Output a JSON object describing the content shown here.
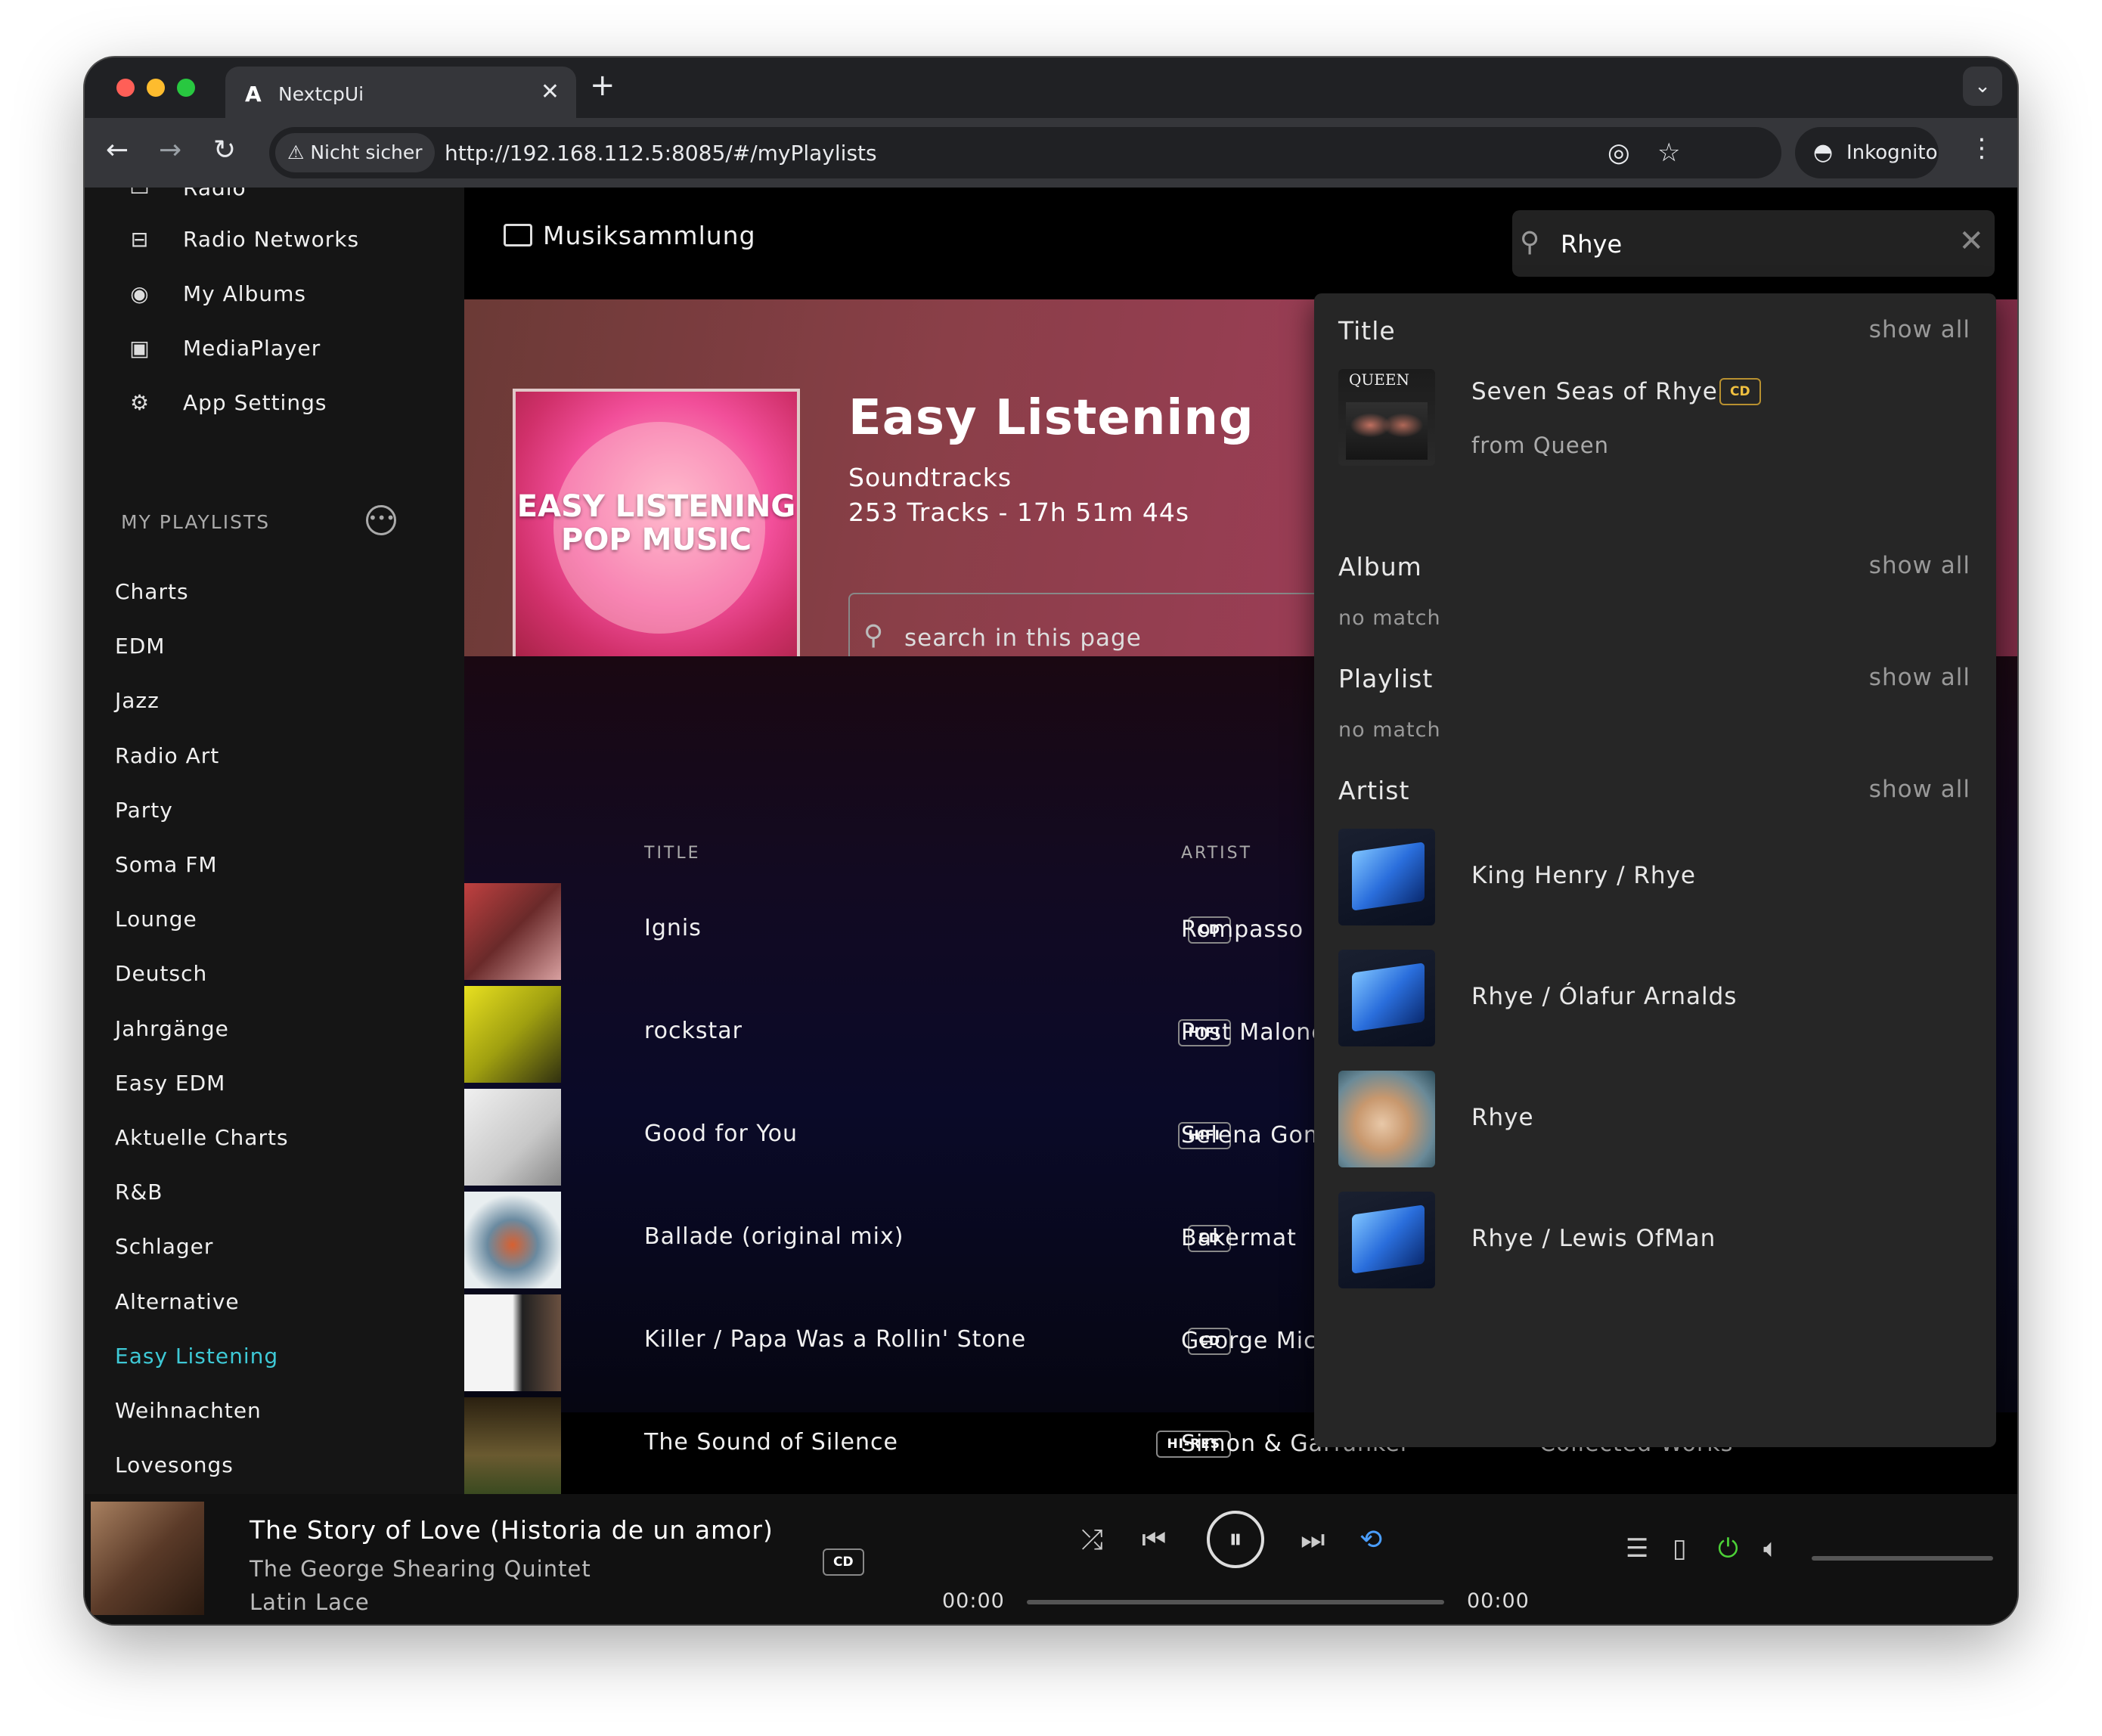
{
  "browser": {
    "tab_title": "NextcpUi",
    "tab_favicon": "A",
    "security_chip": "Nicht sicher",
    "url": "http://192.168.112.5:8085/#/myPlaylists",
    "incognito_label": "Inkognito"
  },
  "sidebar": {
    "nav": [
      {
        "label": "Radio",
        "icon": "radio-icon"
      },
      {
        "label": "Radio Networks",
        "icon": "radio-networks-icon"
      },
      {
        "label": "My Albums",
        "icon": "disc-icon"
      },
      {
        "label": "MediaPlayer",
        "icon": "media-player-icon"
      },
      {
        "label": "App Settings",
        "icon": "gear-icon"
      }
    ],
    "playlists_heading": "MY PLAYLISTS",
    "playlists": [
      "Charts",
      "EDM",
      "Jazz",
      "Radio Art",
      "Party",
      "Soma FM",
      "Lounge",
      "Deutsch",
      "Jahrgänge",
      "Easy EDM",
      "Aktuelle Charts",
      "R&B",
      "Schlager",
      "Alternative",
      "Easy Listening",
      "Weihnachten",
      "Lovesongs"
    ],
    "active_playlist": "Easy Listening",
    "accent_color": "#3ec9d6"
  },
  "header": {
    "breadcrumb": "Musiksammlung",
    "search_value": "Rhye"
  },
  "playlist": {
    "cover_text": "EASY LISTENING POP MUSIC",
    "title": "Easy Listening",
    "subtitle": "Soundtracks",
    "stats": "253 Tracks - 17h 51m 44s",
    "search_placeholder": "search in this page"
  },
  "tracks": {
    "columns": {
      "title": "TITLE",
      "artist": "ARTIST"
    },
    "rows": [
      {
        "title": "Ignis",
        "badge": "CD",
        "artist": "Rompasso",
        "album": ""
      },
      {
        "title": "rockstar",
        "badge": "HIFI",
        "artist": "Post Malone",
        "album": ""
      },
      {
        "title": "Good for You",
        "badge": "HIFI",
        "artist": "Selena Gomez",
        "album": ""
      },
      {
        "title": "Ballade (original mix)",
        "badge": "CD",
        "artist": "Bakermat",
        "album": ""
      },
      {
        "title": "Killer / Papa Was a Rollin' Stone",
        "badge": "CD",
        "artist": "George Michael",
        "album": ""
      },
      {
        "title": "The Sound of Silence",
        "badge": "HI-RES",
        "artist": "Simon & Garfunkel",
        "album": "Collected Works"
      }
    ]
  },
  "search_results": {
    "sections": {
      "title": "Title",
      "album": "Album",
      "playlist": "Playlist",
      "artist": "Artist"
    },
    "show_all": "show all",
    "no_match": "no match",
    "title_result": {
      "title": "Seven Seas of Rhye",
      "badge": "CD",
      "subtitle": "from Queen",
      "cover_text": "QUEEN"
    },
    "artists": [
      "King Henry / Rhye",
      "Rhye / Ólafur Arnalds",
      "Rhye",
      "Rhye / Lewis OfMan"
    ]
  },
  "player": {
    "title": "The Story of Love (Historia de un amor)",
    "artist": "The George Shearing Quintet",
    "album": "Latin Lace",
    "badge": "CD",
    "time_elapsed": "00:00",
    "time_total": "00:00",
    "power_color": "#4cd137"
  }
}
